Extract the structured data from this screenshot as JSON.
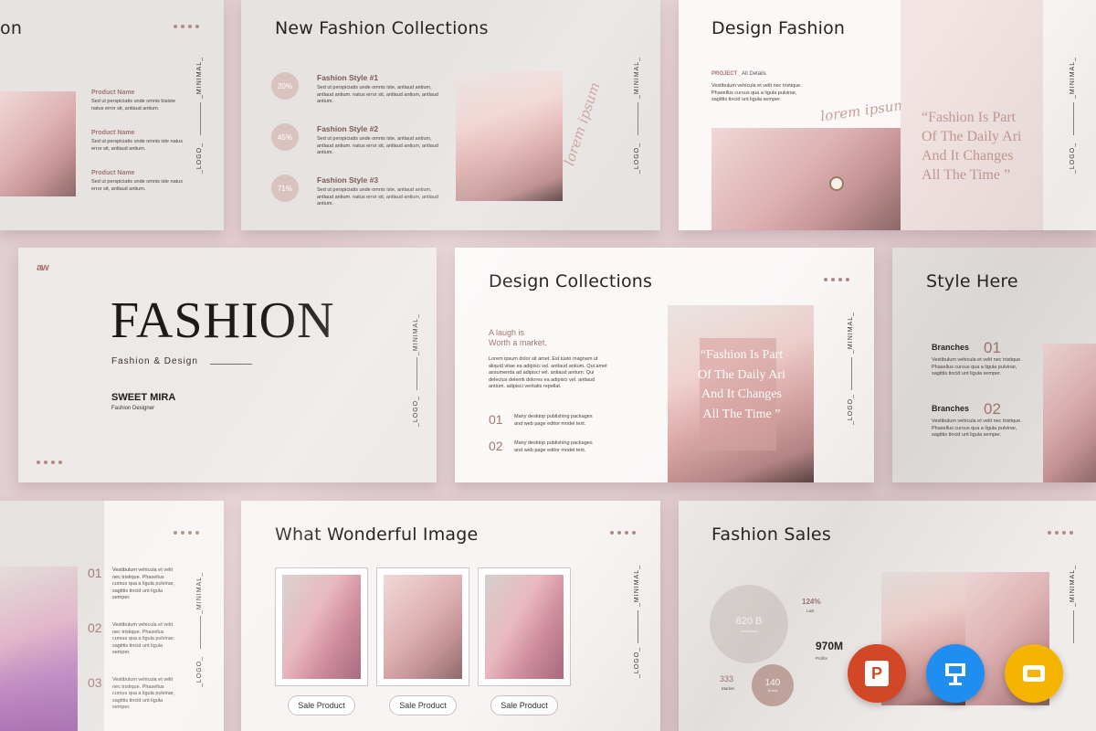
{
  "common": {
    "vertical_minimal": "_MINIMAL_",
    "vertical_logo": "_LOGO_"
  },
  "s1": {
    "title_frag": "on",
    "items": [
      {
        "label": "Product Name",
        "desc": "Sed ut perspiciatis unde omnis bisiste natus error sit, antlaud antium."
      },
      {
        "label": "Product Name",
        "desc": "Sed ut perspiciatis unde omnis iste natus error sit, antlaud antium."
      },
      {
        "label": "Product Name",
        "desc": "Sed ut perspiciatis unde omnis iste natus error sit, antlaud antium."
      }
    ]
  },
  "s2": {
    "title": "New Fashion Collections",
    "items": [
      {
        "pct": "20%",
        "label": "Fashion Style #1",
        "desc": "Sed ut perspiciatis unde omnis iste, antlaud antium, antlaud antium. natus error sit, antlaud antium, antlaud antium."
      },
      {
        "pct": "45%",
        "label": "Fashion Style #2",
        "desc": "Sed ut perspiciatis unde omnis iste, antlaud antium, antlaud antium. natus error sit, antlaud antium, antlaud antium."
      },
      {
        "pct": "71%",
        "label": "Fashion Style #3",
        "desc": "Sed ut perspiciatis unde omnis iste, antlaud antium, antlaud antium. natus error sit, antlaud antium, antlaud antium."
      }
    ],
    "script": "lorem ipsum"
  },
  "s3": {
    "title": "Design Fashion",
    "project_label": "PROJECT_",
    "project_sub": "All Details",
    "desc": "Vestibulum vehicula et velit nec tristique. Phasellus cursus qua a ligula pulvinar, sagittis tincid unt ligula semper.",
    "script": "lorem ipsum",
    "quote": "“Fashion Is Part Of The Daily Ari And It Changes All  The Time ”"
  },
  "s4": {
    "logo": "aw",
    "title": "FASHION",
    "subtitle": "Fashion & Design",
    "name": "SWEET MIRA",
    "role": "Fashion Designer"
  },
  "s5": {
    "title": "Design Collections",
    "lead1": "A laugh is",
    "lead2": "Worth a  market.",
    "body": "Lorem ipsum dolor sit amet. Est iusto magnam ut aliquid vitae ea adipisci vel. antlaud antium. Qui amet assumenda ad adipisci vel. antlaud antium. Qui delectus deleniti dolores ea adipisci vel. antlaud antium. adipisci veritatis repellat.",
    "items": [
      {
        "num": "01",
        "text": "Many desktop publishing packages and web page editor model text."
      },
      {
        "num": "02",
        "text": "Many desktop publishing  packages and web page editor model text."
      }
    ],
    "quote": "“Fashion Is Part Of The Daily Ari And It Changes All  The Time ”"
  },
  "s6": {
    "title": "Style Here",
    "items": [
      {
        "label": "Branches",
        "num": "01",
        "desc": "Vestibulum vehicula et velit nec tristique. Phasellus cursus qua a ligula pulvinar, sagittis tincid unt ligula semper."
      },
      {
        "label": "Branches",
        "num": "02",
        "desc": "Vestibulum vehicula et velit nec tristique. Phasellus cursus qua a ligula pulvinar, sagittis tincid unt ligula semper."
      }
    ]
  },
  "s7": {
    "items": [
      {
        "num": "01",
        "desc": "Vestibulum vehicula et velit nec tristique. Phasellus cursus qua a ligula pulvinar, sagittis tincid unt ligula semper."
      },
      {
        "num": "02",
        "desc": "Vestibulum vehicula et velit nec tristique. Phasellus cursus qua a ligula pulvinar, sagittis tincid unt ligula semper."
      },
      {
        "num": "03",
        "desc": "Vestibulum vehicula et velit nec tristique. Phasellus cursus qua a ligula pulvinar, sagittis tincid unt ligula semper."
      }
    ]
  },
  "s8": {
    "title": "What Wonderful Image",
    "buttons": [
      "Sale Product",
      "Sale Product",
      "Sale Product"
    ]
  },
  "s9": {
    "title": "Fashion Sales",
    "c1_value": "820 B",
    "c1_label": "Investment",
    "pct": "124%",
    "pct_label": "Last",
    "big": "970M",
    "big_label": "Profits",
    "small_num": "333",
    "small_label": "Market",
    "c2_value": "140",
    "c2_label": "Brand"
  },
  "apps": {
    "powerpoint": "P",
    "keynote": "keynote-icon",
    "slides": "google-slides-icon"
  },
  "colors": {
    "background": "#e2cdd0",
    "accent": "#a3766f",
    "slide": "#f5f2f0",
    "powerpoint": "#d24726",
    "keynote": "#1f8ef0",
    "slides": "#f4b400"
  }
}
